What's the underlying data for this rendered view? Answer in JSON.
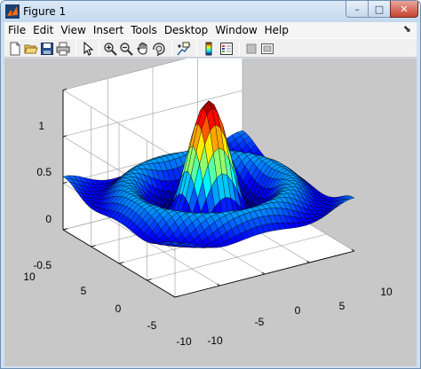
{
  "window": {
    "title": "Figure 1",
    "app_icon": "matlab-icon",
    "controls": {
      "minimize": "–",
      "maximize": "□",
      "close": "✕"
    }
  },
  "menubar": {
    "items": [
      "File",
      "Edit",
      "View",
      "Insert",
      "Tools",
      "Desktop",
      "Window",
      "Help"
    ],
    "dock_arrow": "⬊"
  },
  "toolbar": {
    "tools": [
      "new-figure-icon",
      "open-file-icon",
      "save-icon",
      "print-icon",
      "edit-plot-arrow-icon",
      "zoom-in-icon",
      "zoom-out-icon",
      "pan-hand-icon",
      "rotate-3d-icon",
      "data-cursor-icon",
      "insert-colorbar-icon",
      "insert-legend-icon",
      "hide-plot-tools-icon",
      "show-plot-tools-icon"
    ]
  },
  "plot": {
    "z_ticks": [
      "1",
      "0.5",
      "0",
      "-0.5"
    ],
    "y_ticks": [
      "10",
      "5",
      "0",
      "-5",
      "-10"
    ],
    "x_ticks": [
      "-10",
      "-5",
      "0",
      "5",
      "10"
    ]
  },
  "chart_data": {
    "type": "surface",
    "function": "sinc (sin(r)/r) mexican-hat style peak",
    "x_range": [
      -10,
      10
    ],
    "y_range": [
      -10,
      10
    ],
    "z_range": [
      -0.5,
      1
    ],
    "peak_z": 1,
    "colormap": "jet",
    "grid": true,
    "colors": {
      "figure_background": "#c8c8c8",
      "axes_background": "#ffffff",
      "edge_color": "#000000"
    }
  }
}
